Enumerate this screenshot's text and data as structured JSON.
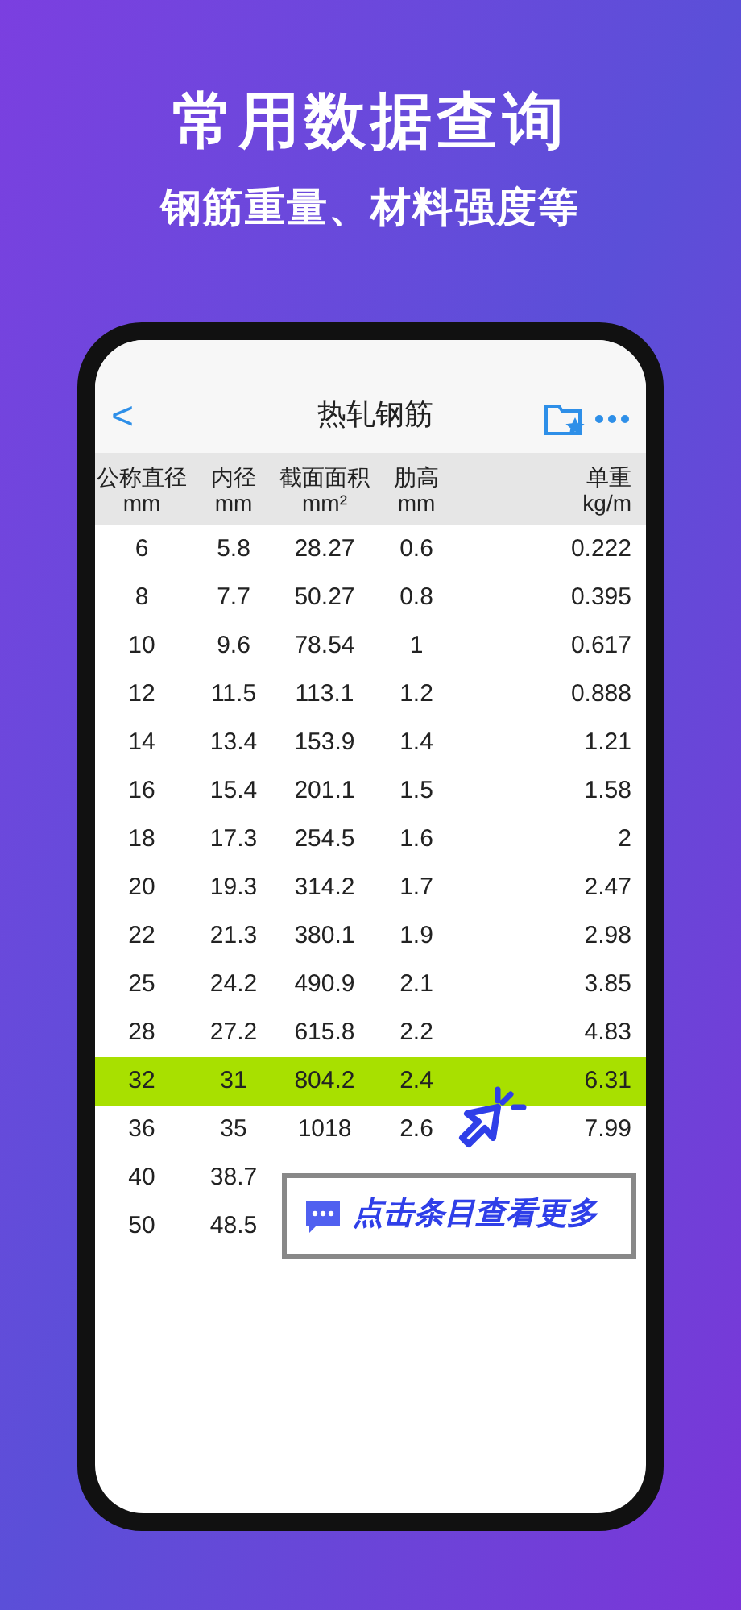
{
  "promo": {
    "title": "常用数据查询",
    "subtitle": "钢筋重量、材料强度等"
  },
  "nav": {
    "back": "<",
    "title": "热轧钢筋"
  },
  "table": {
    "columns": [
      {
        "name": "公称直径",
        "unit": "mm"
      },
      {
        "name": "内径",
        "unit": "mm"
      },
      {
        "name": "截面面积",
        "unit": "mm²"
      },
      {
        "name": "肋高",
        "unit": "mm"
      },
      {
        "name": "单重",
        "unit": "kg/m"
      }
    ],
    "rows": [
      {
        "cells": [
          "6",
          "5.8",
          "28.27",
          "0.6",
          "0.222"
        ],
        "selected": false
      },
      {
        "cells": [
          "8",
          "7.7",
          "50.27",
          "0.8",
          "0.395"
        ],
        "selected": false
      },
      {
        "cells": [
          "10",
          "9.6",
          "78.54",
          "1",
          "0.617"
        ],
        "selected": false
      },
      {
        "cells": [
          "12",
          "11.5",
          "113.1",
          "1.2",
          "0.888"
        ],
        "selected": false
      },
      {
        "cells": [
          "14",
          "13.4",
          "153.9",
          "1.4",
          "1.21"
        ],
        "selected": false
      },
      {
        "cells": [
          "16",
          "15.4",
          "201.1",
          "1.5",
          "1.58"
        ],
        "selected": false
      },
      {
        "cells": [
          "18",
          "17.3",
          "254.5",
          "1.6",
          "2"
        ],
        "selected": false
      },
      {
        "cells": [
          "20",
          "19.3",
          "314.2",
          "1.7",
          "2.47"
        ],
        "selected": false
      },
      {
        "cells": [
          "22",
          "21.3",
          "380.1",
          "1.9",
          "2.98"
        ],
        "selected": false
      },
      {
        "cells": [
          "25",
          "24.2",
          "490.9",
          "2.1",
          "3.85"
        ],
        "selected": false
      },
      {
        "cells": [
          "28",
          "27.2",
          "615.8",
          "2.2",
          "4.83"
        ],
        "selected": false
      },
      {
        "cells": [
          "32",
          "31",
          "804.2",
          "2.4",
          "6.31"
        ],
        "selected": true
      },
      {
        "cells": [
          "36",
          "35",
          "1018",
          "2.6",
          "7.99"
        ],
        "selected": false
      },
      {
        "cells": [
          "40",
          "38.7"
        ],
        "selected": false
      },
      {
        "cells": [
          "50",
          "48.5"
        ],
        "selected": false
      }
    ]
  },
  "hint": {
    "text": "点击条目查看更多"
  }
}
